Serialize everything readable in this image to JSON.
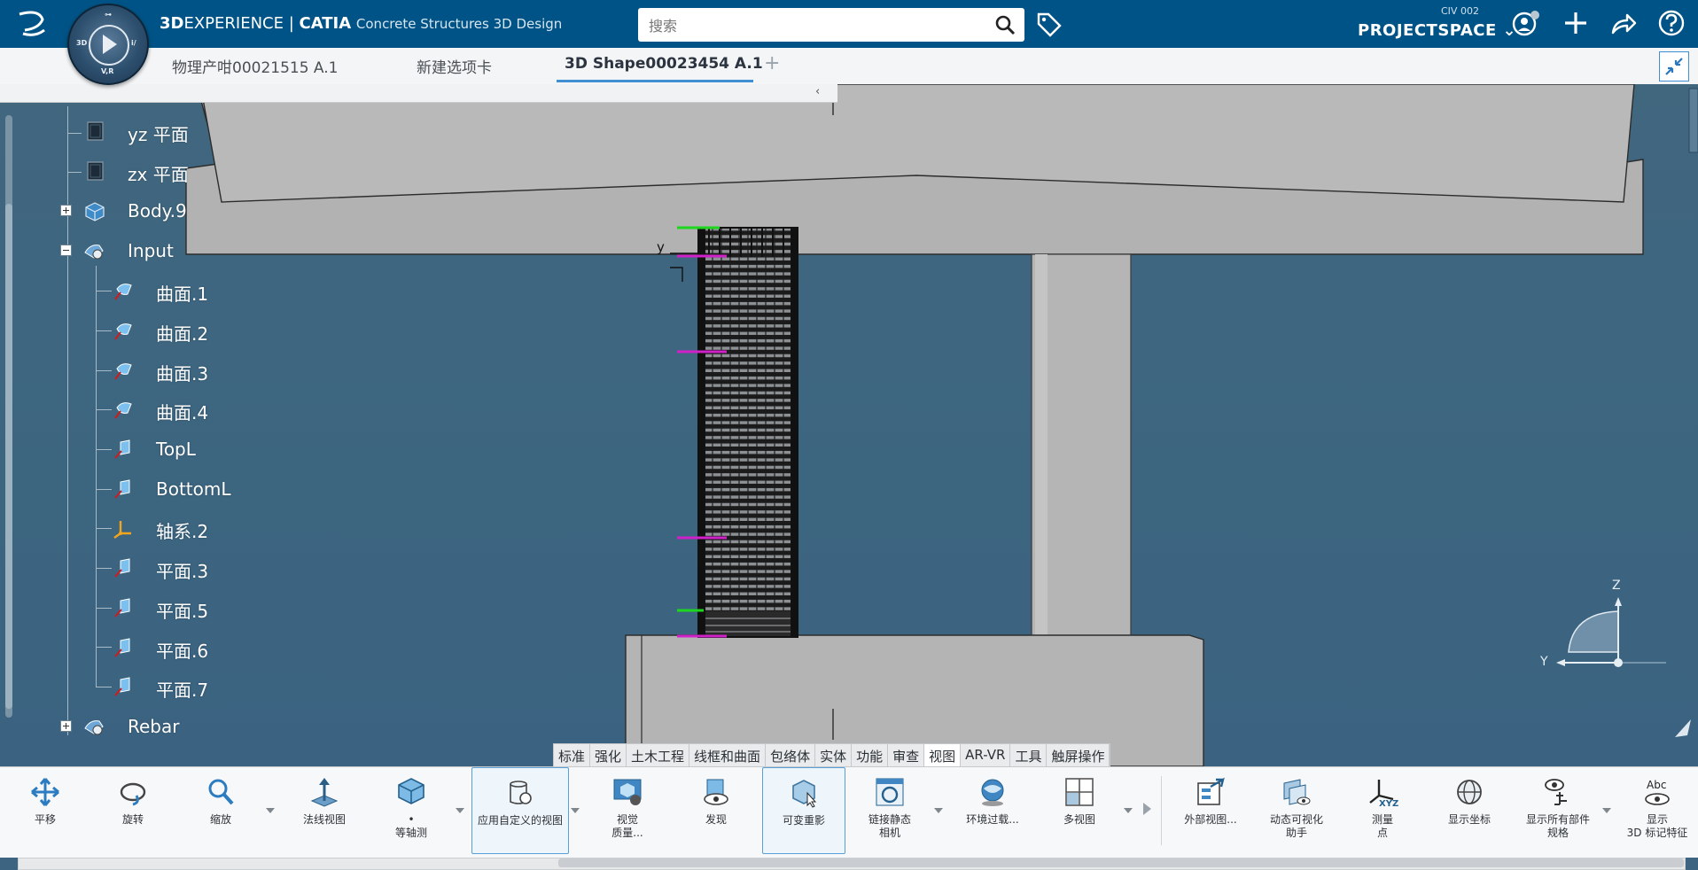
{
  "header": {
    "brand_prefix": "3D",
    "brand_experience": "EXPERIENCE",
    "brand_sep": " | ",
    "brand_catia": "CATIA",
    "app_name": "Concrete Structures 3D Design",
    "compass_labels": {
      "top": "⊶",
      "left": "3D",
      "right": "i/",
      "bottom": "V,R"
    },
    "search_placeholder": "搜索",
    "org": "CIV 002",
    "space": "PROJECTSPACE ⌄"
  },
  "tabs": [
    {
      "label": "物理产咁00021515 A.1",
      "active": false
    },
    {
      "label": "新建选项卡",
      "active": false
    },
    {
      "label": "3D Shape00023454 A.1",
      "active": true
    }
  ],
  "tab_add": "+",
  "tree": {
    "collapse_arrow": "‹",
    "items": [
      {
        "label": "yz 平面",
        "icon": "plane-icon"
      },
      {
        "label": "zx 平面",
        "icon": "plane-icon"
      },
      {
        "label": "Body.9",
        "icon": "body-icon",
        "expander": "plus"
      },
      {
        "label": "Input",
        "icon": "geometric-set-icon",
        "expander": "minus"
      },
      {
        "label": "曲面.1",
        "icon": "surface-icon"
      },
      {
        "label": "曲面.2",
        "icon": "surface-icon"
      },
      {
        "label": "曲面.3",
        "icon": "surface-icon"
      },
      {
        "label": "曲面.4",
        "icon": "surface-icon"
      },
      {
        "label": "TopL",
        "icon": "plane-feature-icon"
      },
      {
        "label": "BottomL",
        "icon": "plane-feature-icon"
      },
      {
        "label": "轴系.2",
        "icon": "axis-system-icon"
      },
      {
        "label": "平面.3",
        "icon": "plane-feature-icon"
      },
      {
        "label": "平面.5",
        "icon": "plane-feature-icon"
      },
      {
        "label": "平面.6",
        "icon": "plane-feature-icon"
      },
      {
        "label": "平面.7",
        "icon": "plane-feature-icon"
      },
      {
        "label": "Rebar",
        "icon": "geometric-set-icon",
        "expander": "plus"
      }
    ]
  },
  "viewport": {
    "axis_y_label": "y",
    "compass_z": "Z",
    "compass_y": "Y"
  },
  "command_tabs": [
    "标准",
    "强化",
    "土木工程",
    "线框和曲面",
    "包络体",
    "实体",
    "功能",
    "审查",
    "视图",
    "AR-VR",
    "工具",
    "触屏操作"
  ],
  "active_command_tab": "视图",
  "toolbar": {
    "pan": "平移",
    "rotate": "旋转",
    "zoom": "缩放",
    "normal_view": "法线视图",
    "iso_dot": "•",
    "iso": "等轴测",
    "custom_view": "应用自定义的视图",
    "visual_quality_1": "视觉",
    "visual_quality_2": "质量...",
    "discover": "发现",
    "ghosting": "可变重影",
    "linked_camera_1": "链接静态",
    "linked_camera_2": "相机",
    "env_filter": "环境过载...",
    "multi_view": "多视图",
    "external_view": "外部视图...",
    "viz_assist_1": "动态可视化",
    "viz_assist_2": "助手",
    "measure_1": "测量",
    "measure_2": "点",
    "show_coords": "显示坐标",
    "show_specs_1": "显示所有部件",
    "show_specs_2": "规格",
    "show_3d_1": "显示",
    "show_3d_2": "3D 标记特征"
  }
}
